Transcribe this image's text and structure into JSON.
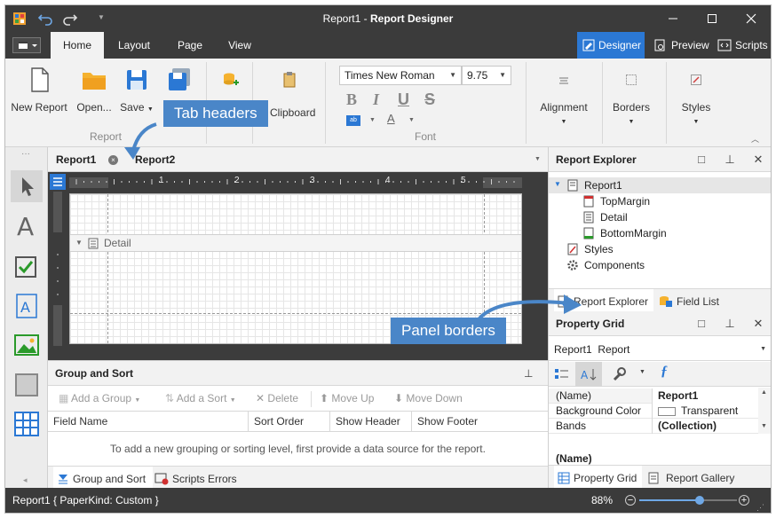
{
  "app": {
    "doc_name": "Report1",
    "separator": " - ",
    "app_name": "Report Designer"
  },
  "ribbon_tabs": [
    "Home",
    "Layout",
    "Page",
    "View"
  ],
  "view_tabs": [
    "Designer",
    "Preview",
    "Scripts"
  ],
  "ribbon": {
    "report_group": {
      "label": "Report",
      "new_report": "New Report",
      "open": "Open...",
      "save": "Save"
    },
    "clipboard_label": "Clipboard",
    "font_group": {
      "label": "Font",
      "font_name": "Times New Roman",
      "font_size": "9.75"
    },
    "alignment": "Alignment",
    "borders": "Borders",
    "styles": "Styles"
  },
  "doc_tabs": [
    "Report1",
    "Report2"
  ],
  "ruler_marks": [
    "1",
    "2",
    "3",
    "4",
    "5"
  ],
  "band_label": "Detail",
  "group_sort": {
    "title": "Group and Sort",
    "buttons": [
      "Add a Group",
      "Add a Sort",
      "Delete",
      "Move Up",
      "Move Down"
    ],
    "columns": [
      "Field Name",
      "Sort Order",
      "Show Header",
      "Show Footer"
    ],
    "message": "To add a new grouping or sorting level, first provide a data source for the report.",
    "bottom_tabs": [
      "Group and Sort",
      "Scripts Errors"
    ]
  },
  "explorer": {
    "title": "Report Explorer",
    "tree": [
      "Report1",
      "TopMargin",
      "Detail",
      "BottomMargin",
      "Styles",
      "Components"
    ],
    "bottom_tabs": [
      "Report Explorer",
      "Field List"
    ]
  },
  "property_grid": {
    "title": "Property Grid",
    "selector_name": "Report1",
    "selector_type": "Report",
    "rows": [
      {
        "name": "(Name)",
        "value": "Report1"
      },
      {
        "name": "Background Color",
        "value": "Transparent"
      },
      {
        "name": "Bands",
        "value": "(Collection)"
      }
    ],
    "description": "(Name)",
    "bottom_tabs": [
      "Property Grid",
      "Report Gallery"
    ]
  },
  "status": {
    "text": "Report1 { PaperKind: Custom }",
    "zoom": "88%",
    "zoom_level": 0.62
  },
  "callouts": {
    "tab_headers": "Tab headers",
    "panel_borders": "Panel borders"
  },
  "colors": {
    "accent": "#2b78d4",
    "callout": "#4a86c8",
    "dark": "#3b3b3b"
  }
}
